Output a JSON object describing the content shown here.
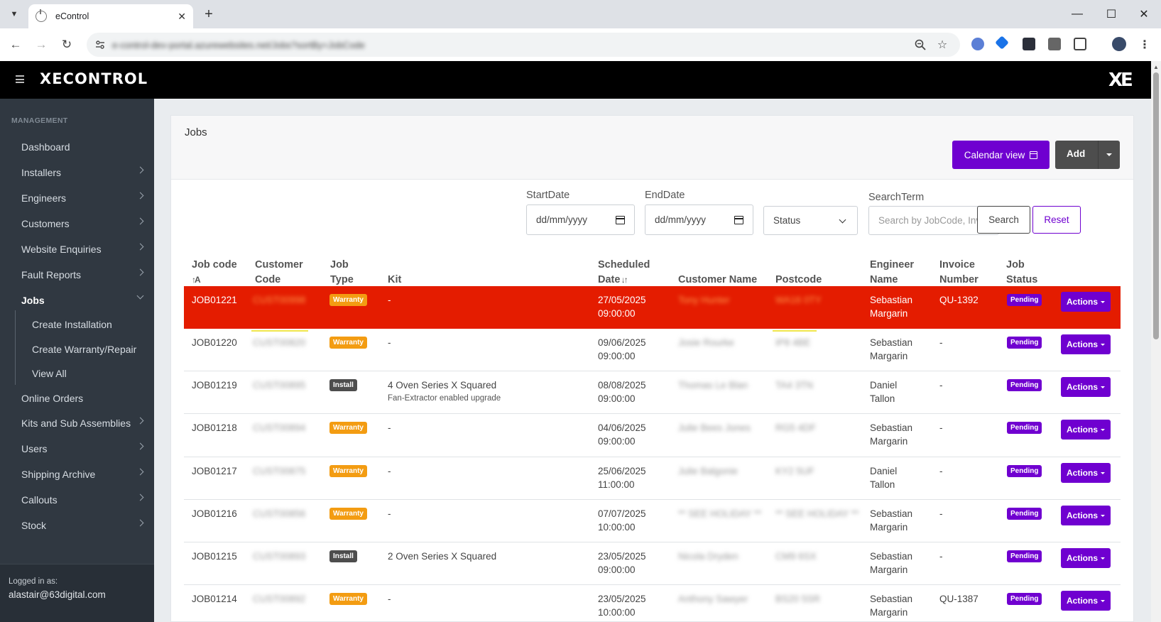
{
  "browser": {
    "tab_title": "eControl",
    "url": "e-control-dev-portal.azurewebsites.net/Jobs?sortBy=JobCode"
  },
  "app": {
    "logo_text": "XECONTROL",
    "logo_mark": "XE"
  },
  "sidebar": {
    "heading": "MANAGEMENT",
    "items": [
      {
        "label": "Dashboard",
        "chevron": false
      },
      {
        "label": "Installers",
        "chevron": true
      },
      {
        "label": "Engineers",
        "chevron": true
      },
      {
        "label": "Customers",
        "chevron": true
      },
      {
        "label": "Website Enquiries",
        "chevron": true
      },
      {
        "label": "Fault Reports",
        "chevron": true
      },
      {
        "label": "Jobs",
        "chevron": true,
        "active": true
      },
      {
        "label": "Online Orders",
        "chevron": false
      },
      {
        "label": "Kits and Sub Assemblies",
        "chevron": true
      },
      {
        "label": "Users",
        "chevron": true
      },
      {
        "label": "Shipping Archive",
        "chevron": true
      },
      {
        "label": "Callouts",
        "chevron": true
      },
      {
        "label": "Stock",
        "chevron": true
      }
    ],
    "jobs_sub": [
      "Create Installation",
      "Create Warranty/Repair",
      "View All"
    ],
    "footer_label": "Logged in as:",
    "footer_user": "alastair@63digital.com"
  },
  "page": {
    "title": "Jobs",
    "calendar_btn": "Calendar view",
    "add_btn": "Add"
  },
  "filters": {
    "start_label": "StartDate",
    "end_label": "EndDate",
    "date_placeholder": "dd/mm/yyyy",
    "status_value": "Status",
    "search_label": "SearchTerm",
    "search_placeholder": "Search by JobCode, Invoice",
    "search_btn": "Search",
    "reset_btn": "Reset"
  },
  "table": {
    "headers": {
      "job_code": "Job code",
      "customer_code_1": "Customer",
      "customer_code_2": "Code",
      "job_type_1": "Job",
      "job_type_2": "Type",
      "kit": "Kit",
      "sched_1": "Scheduled",
      "sched_2": "Date",
      "customer_name": "Customer Name",
      "postcode": "Postcode",
      "engineer_1": "Engineer",
      "engineer_2": "Name",
      "invoice_1": "Invoice",
      "invoice_2": "Number",
      "status_1": "Job",
      "status_2": "Status"
    },
    "actions_label": "Actions",
    "rows": [
      {
        "job_code": "JOB01221",
        "customer_code": "CUST00998",
        "type": "Warranty",
        "kit": "-",
        "kit_sub": "",
        "date": "27/05/2025",
        "time": "09:00:00",
        "customer_name": "Tony Hunter",
        "postcode": "WA16 0TY",
        "eng1": "Sebastian",
        "eng2": "Margarin",
        "invoice": "QU-1392",
        "status": "Pending"
      },
      {
        "job_code": "JOB01220",
        "customer_code": "CUST00820",
        "type": "Warranty",
        "kit": "-",
        "kit_sub": "",
        "date": "09/06/2025",
        "time": "09:00:00",
        "customer_name": "Josie Rourke",
        "postcode": "IP8 4BE",
        "eng1": "Sebastian",
        "eng2": "Margarin",
        "invoice": "-",
        "status": "Pending"
      },
      {
        "job_code": "JOB01219",
        "customer_code": "CUST00895",
        "type": "Install",
        "kit": "4 Oven Series X Squared",
        "kit_sub": "Fan-Extractor enabled upgrade",
        "date": "08/08/2025",
        "time": "09:00:00",
        "customer_name": "Thomas Le Blan",
        "postcode": "TA4 3TN",
        "eng1": "Daniel",
        "eng2": "Tallon",
        "invoice": "-",
        "status": "Pending"
      },
      {
        "job_code": "JOB01218",
        "customer_code": "CUST00894",
        "type": "Warranty",
        "kit": "-",
        "kit_sub": "",
        "date": "04/06/2025",
        "time": "09:00:00",
        "customer_name": "Julie Bees Jones",
        "postcode": "RG5 4DF",
        "eng1": "Sebastian",
        "eng2": "Margarin",
        "invoice": "-",
        "status": "Pending"
      },
      {
        "job_code": "JOB01217",
        "customer_code": "CUST00875",
        "type": "Warranty",
        "kit": "-",
        "kit_sub": "",
        "date": "25/06/2025",
        "time": "11:00:00",
        "customer_name": "Julie Balgonie",
        "postcode": "KY2 5UF",
        "eng1": "Daniel",
        "eng2": "Tallon",
        "invoice": "-",
        "status": "Pending"
      },
      {
        "job_code": "JOB01216",
        "customer_code": "CUST00856",
        "type": "Warranty",
        "kit": "-",
        "kit_sub": "",
        "date": "07/07/2025",
        "time": "10:00:00",
        "customer_name": "** SEE HOLIDAY **",
        "postcode": "** SEE HOLIDAY **",
        "eng1": "Sebastian",
        "eng2": "Margarin",
        "invoice": "-",
        "status": "Pending"
      },
      {
        "job_code": "JOB01215",
        "customer_code": "CUST00893",
        "type": "Install",
        "kit": "2 Oven Series X Squared",
        "kit_sub": "",
        "date": "23/05/2025",
        "time": "09:00:00",
        "customer_name": "Nicola Dryden",
        "postcode": "CM9 6SX",
        "eng1": "Sebastian",
        "eng2": "Margarin",
        "invoice": "-",
        "status": "Pending"
      },
      {
        "job_code": "JOB01214",
        "customer_code": "CUST00892",
        "type": "Warranty",
        "kit": "-",
        "kit_sub": "",
        "date": "23/05/2025",
        "time": "10:00:00",
        "customer_name": "Anthony Sawyer",
        "postcode": "BS20 5SR",
        "eng1": "Sebastian",
        "eng2": "Margarin",
        "invoice": "QU-1387",
        "status": "Pending"
      }
    ]
  }
}
